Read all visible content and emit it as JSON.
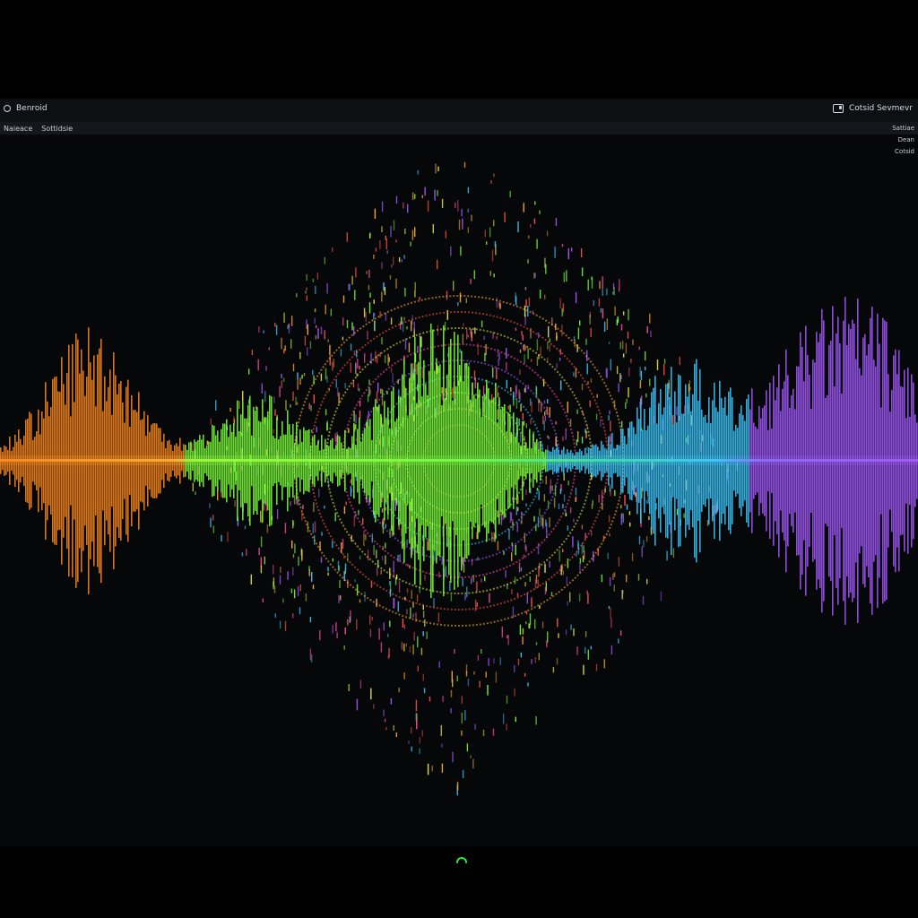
{
  "window": {
    "title": "Benroid",
    "title_right_label": "Cotsid Sevmevr"
  },
  "menu": {
    "items": [
      "Naieace",
      "Sottidsie"
    ]
  },
  "side_menu": {
    "items": [
      "Sattiae",
      "Dean",
      "Cotsid"
    ]
  },
  "colors": {
    "orange": "#ff8a1f",
    "green": "#7dff3c",
    "cyan": "#3ec8ff",
    "purple": "#a45bff",
    "indicator": "#2ee84a"
  },
  "icons": {
    "title_left": "circle-icon",
    "title_right": "toggle-icon",
    "bottom": "spinner-arc-icon"
  }
}
